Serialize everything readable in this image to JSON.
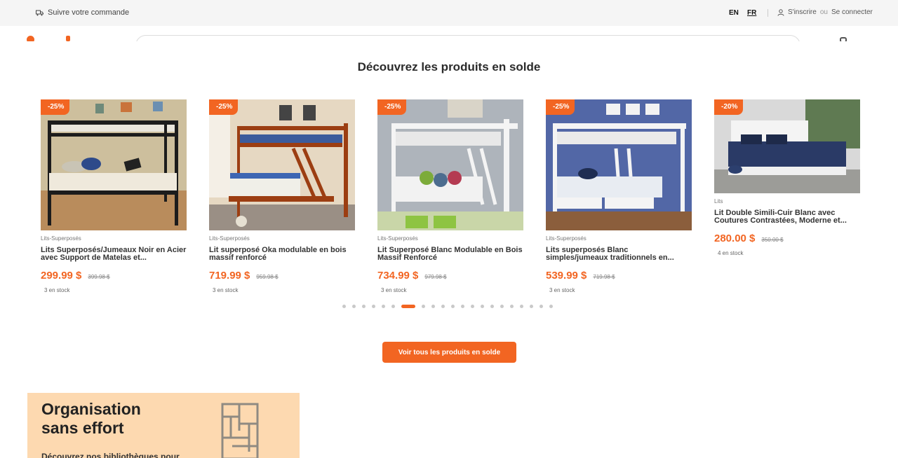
{
  "topbar": {
    "track_order": "Suivre votre commande",
    "lang_en": "EN",
    "lang_fr": "FR",
    "signup": "S'inscrire",
    "or": "ou",
    "login": "Se connecter"
  },
  "sale": {
    "title": "Découvrez les produits en solde",
    "cta": "Voir tous les produits en solde",
    "products": [
      {
        "badge": "-25%",
        "category": "Lits-Superposés",
        "name": "Lits Superposés/Jumeaux Noir en Acier avec Support de Matelas et...",
        "price": "299.99 $",
        "old_price": "399.98 $",
        "stock": "3 en stock"
      },
      {
        "badge": "-25%",
        "category": "Lits-Superposés",
        "name": "Lit superposé Oka modulable en bois massif renforcé",
        "price": "719.99 $",
        "old_price": "959.98 $",
        "stock": "3 en stock"
      },
      {
        "badge": "-25%",
        "category": "Lits-Superposés",
        "name": "Lit Superposé Blanc Modulable en Bois Massif Renforcé",
        "price": "734.99 $",
        "old_price": "979.98 $",
        "stock": "3 en stock"
      },
      {
        "badge": "-25%",
        "category": "Lits-Superposés",
        "name": "Lits superposés Blanc simples/jumeaux traditionnels en...",
        "price": "539.99 $",
        "old_price": "719.98 $",
        "stock": "3 en stock"
      },
      {
        "badge": "-20%",
        "category": "Lits",
        "name": "Lit Double Simili-Cuir Blanc avec Coutures Contrastées, Moderne et...",
        "price": "280.00 $",
        "old_price": "350.00 $",
        "stock": "4 en stock"
      }
    ],
    "pagination": {
      "total": 21,
      "active": 6
    }
  },
  "promo": {
    "title": "Organisation sans effort",
    "subtitle": "Découvrez nos bibliothèques pour"
  },
  "colors": {
    "accent": "#f26522",
    "topbar_bg": "#f5f5f5",
    "promo_bg": "#fdd9b0"
  }
}
